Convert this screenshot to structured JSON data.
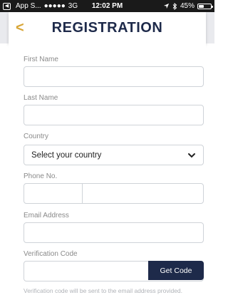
{
  "status": {
    "back_app": "App S...",
    "signal": "●●●●●",
    "network": "3G",
    "time": "12:02 PM",
    "battery_text": "45%",
    "battery_level": 0.45,
    "icons": [
      "back-arrow-icon",
      "location-icon",
      "bluetooth-icon",
      "battery-icon"
    ]
  },
  "header": {
    "back_symbol": "<",
    "title": "REGISTRATION"
  },
  "form": {
    "first_name_label": "First Name",
    "first_name_value": "",
    "last_name_label": "Last Name",
    "last_name_value": "",
    "country_label": "Country",
    "country_value": "Select your country",
    "phone_label": "Phone No.",
    "phone_code_value": "",
    "phone_number_value": "",
    "email_label": "Email Address",
    "email_value": "",
    "verification_label": "Verification Code",
    "verification_value": "",
    "get_code_label": "Get Code",
    "hint": "Verification code will be sent to the email address provided."
  },
  "colors": {
    "accent": "#d8a536",
    "primary": "#1e2a4a",
    "status_bar": "#1a1a1a",
    "field_border": "#cfd3d8"
  }
}
